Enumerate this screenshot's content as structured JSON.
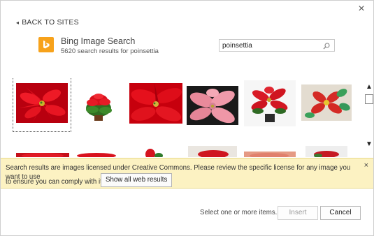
{
  "dialog": {
    "close_label": "×",
    "back_label": "BACK TO SITES"
  },
  "provider": {
    "title": "Bing Image Search",
    "subtitle": "5620 search results for poinsettia",
    "brand_color": "#f7a21b"
  },
  "search": {
    "value": "poinsettia",
    "icon": "search-icon"
  },
  "results": {
    "images": [
      {
        "name": "result-image-1",
        "selected": true
      },
      {
        "name": "result-image-2",
        "selected": false
      },
      {
        "name": "result-image-3",
        "selected": false
      },
      {
        "name": "result-image-4",
        "selected": false
      },
      {
        "name": "result-image-5",
        "selected": false
      },
      {
        "name": "result-image-6",
        "selected": false
      }
    ],
    "scroll_up": "▲",
    "scroll_down": "▼"
  },
  "notice": {
    "text": "Search results are images licensed under Creative Commons. Please review the specific license for any image you want to use",
    "line2": "to ensure you can comply with it.",
    "button_label": "Show all web results",
    "close_label": "×",
    "bg_color": "#fcf2c2"
  },
  "footer": {
    "status": "Select one or more items.",
    "insert_label": "Insert",
    "cancel_label": "Cancel"
  }
}
